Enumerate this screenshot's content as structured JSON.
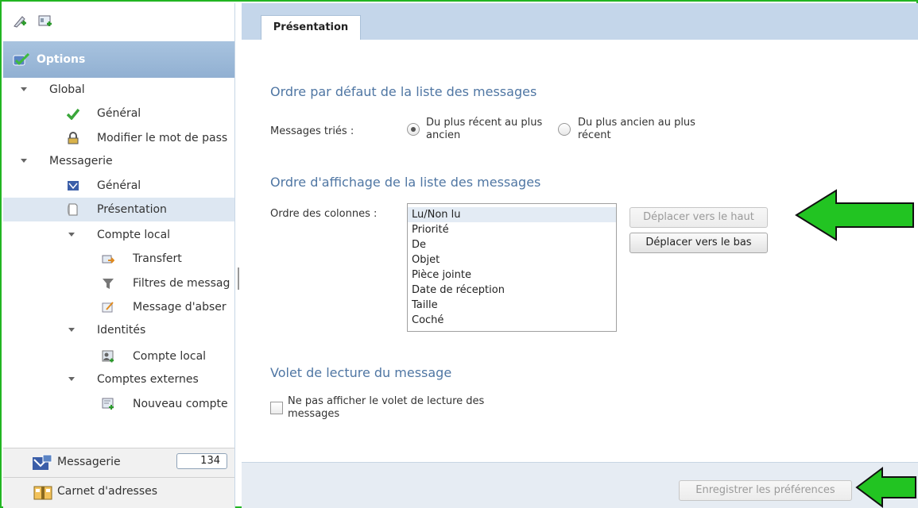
{
  "sidebar": {
    "header": "Options",
    "tree": {
      "global": "Global",
      "global_general": "Général",
      "change_password": "Modifier le mot de pass",
      "messagerie": "Messagerie",
      "msg_general": "Général",
      "presentation": "Présentation",
      "local_account": "Compte local",
      "transfer": "Transfert",
      "filters": "Filtres de messag",
      "away_message": "Message d'abser",
      "identities": "Identités",
      "identity_local": "Compte local",
      "external_accounts": "Comptes externes",
      "new_account": "Nouveau compte"
    },
    "bottom": {
      "mail_label": "Messagerie",
      "mail_count": "134",
      "contacts_label": "Carnet d'adresses"
    }
  },
  "tab": {
    "label": "Présentation"
  },
  "sort": {
    "heading": "Ordre par défaut de la liste des messages",
    "label": "Messages triés :",
    "opt_recent_1": "Du plus récent au plus",
    "opt_recent_2": "ancien",
    "opt_old_1": "Du plus ancien au plus",
    "opt_old_2": "récent",
    "selected": "recent"
  },
  "display_order": {
    "heading": "Ordre d'affichage de la liste des messages",
    "label": "Ordre des colonnes :",
    "columns": [
      "Lu/Non lu",
      "Priorité",
      "De",
      "Objet",
      "Pièce jointe",
      "Date de réception",
      "Taille",
      "Coché"
    ],
    "selected_index": 0,
    "move_up": "Déplacer vers le haut",
    "move_down": "Déplacer vers le bas"
  },
  "reading_pane": {
    "heading": "Volet de lecture du message",
    "checkbox_1": "Ne pas afficher le volet de lecture des",
    "checkbox_2": "messages",
    "checked": false
  },
  "footer": {
    "save": "Enregistrer les préférences"
  },
  "colors": {
    "accent_green": "#22b522",
    "heading_blue": "#4f76a3",
    "tab_bar": "#c4d6ea",
    "header_bar": "#91b0d2"
  }
}
